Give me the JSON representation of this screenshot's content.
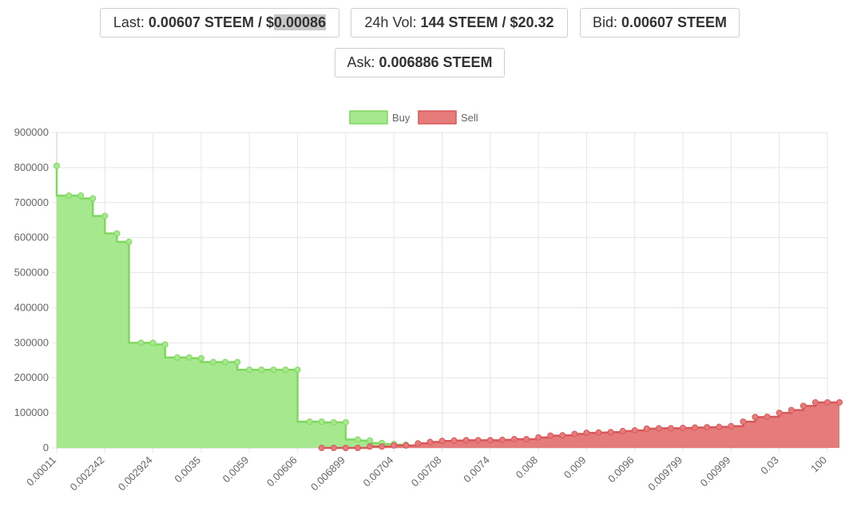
{
  "stats": {
    "last": {
      "label": "Last:",
      "value": "0.00607 STEEM / $",
      "usd": "0.00086"
    },
    "vol": {
      "label": "24h Vol:",
      "value": "144 STEEM / $20.32"
    },
    "bid": {
      "label": "Bid:",
      "value": "0.00607 STEEM"
    },
    "ask": {
      "label": "Ask:",
      "value": "0.006886 STEEM"
    }
  },
  "colors": {
    "buy_fill": "#a6e88e",
    "buy_line": "#7fd85e",
    "sell_fill": "#e57b7b",
    "sell_line": "#d8585a",
    "grid": "#e6e6e6"
  },
  "chart_data": {
    "type": "area",
    "legend": {
      "position": "top-center",
      "items": [
        "Buy",
        "Sell"
      ]
    },
    "y_ticks": [
      "900000",
      "800000",
      "700000",
      "600000",
      "500000",
      "400000",
      "300000",
      "200000",
      "100000",
      "0"
    ],
    "ylim": [
      0,
      900000
    ],
    "x_tick_labels": [
      "0.00011",
      "0.002242",
      "0.002924",
      "0.0035",
      "0.0059",
      "0.00606",
      "0.006899",
      "0.00704",
      "0.00708",
      "0.0074",
      "0.008",
      "0.009",
      "0.0096",
      "0.009799",
      "0.00999",
      "0.03",
      "100"
    ],
    "grid": true,
    "n_points": 65,
    "series": [
      {
        "name": "Buy",
        "start_index": 0,
        "values": [
          805000,
          720000,
          720000,
          712000,
          662000,
          612000,
          588000,
          300000,
          300000,
          295000,
          258000,
          258000,
          256000,
          245000,
          245000,
          245000,
          223000,
          223000,
          223000,
          223000,
          223000,
          75000,
          75000,
          73000,
          73000,
          24000,
          21000,
          14000,
          11000,
          9000
        ]
      },
      {
        "name": "Sell",
        "start_index": 22,
        "values": [
          0,
          0,
          0,
          0,
          4000,
          4000,
          7000,
          7000,
          13000,
          17000,
          20000,
          21000,
          22000,
          22000,
          22000,
          23000,
          25000,
          25000,
          30000,
          35000,
          36000,
          40000,
          43000,
          44000,
          45000,
          48000,
          50000,
          55000,
          56000,
          56000,
          57000,
          58000,
          59000,
          60000,
          62000,
          75000,
          88000,
          89000,
          100000,
          108000,
          120000,
          130000,
          130000,
          130000
        ]
      }
    ]
  }
}
